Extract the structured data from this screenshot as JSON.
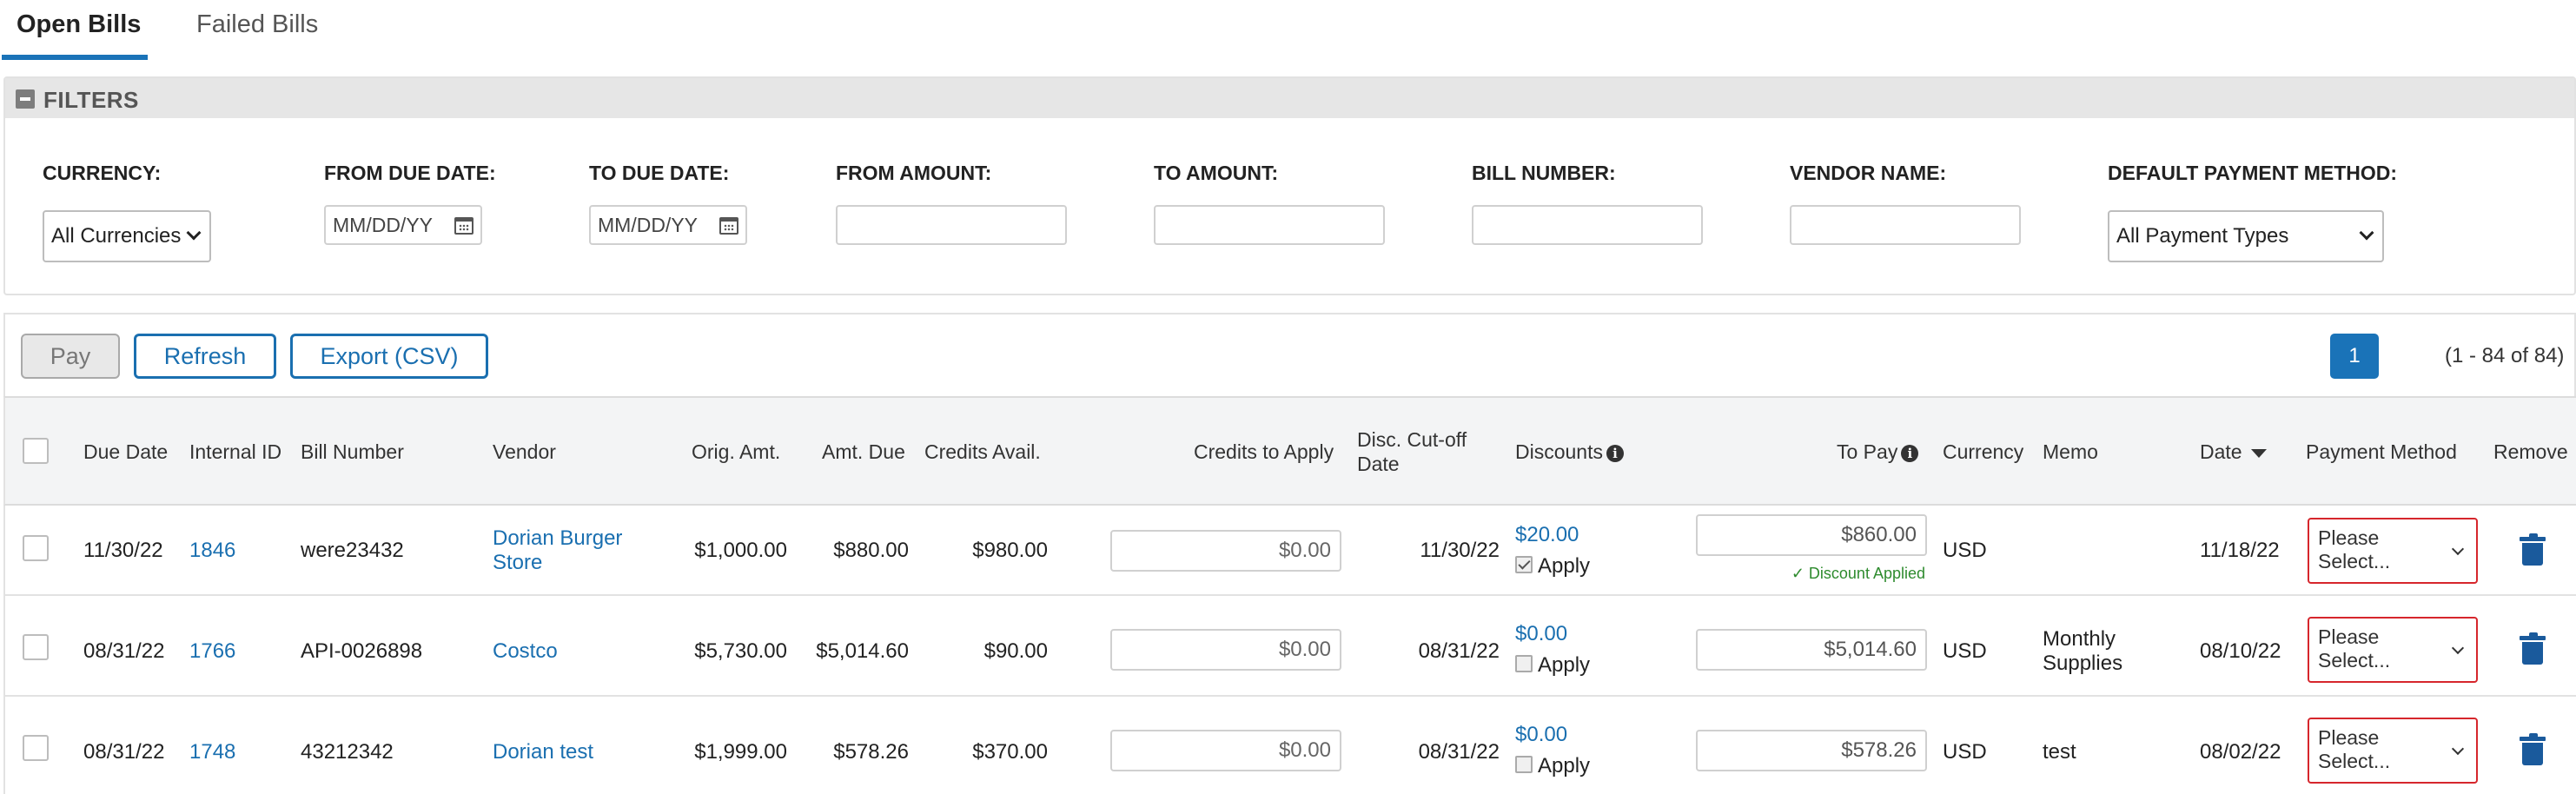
{
  "tabs": {
    "open": "Open Bills",
    "failed": "Failed Bills"
  },
  "filters": {
    "title": "FILTERS",
    "currency_label": "CURRENCY:",
    "currency_value": "All Currencies",
    "from_due_label": "FROM DUE DATE:",
    "from_due_placeholder": "MM/DD/YY",
    "to_due_label": "TO DUE DATE:",
    "to_due_placeholder": "MM/DD/YY",
    "from_amount_label": "FROM AMOUNT:",
    "to_amount_label": "TO AMOUNT:",
    "bill_number_label": "BILL NUMBER:",
    "vendor_name_label": "VENDOR NAME:",
    "payment_method_label": "DEFAULT PAYMENT METHOD:",
    "payment_method_value": "All Payment Types"
  },
  "actions": {
    "pay": "Pay",
    "refresh": "Refresh",
    "export": "Export (CSV)"
  },
  "pagination": {
    "page": "1",
    "info": "(1 - 84 of 84)"
  },
  "columns": {
    "due_date": "Due Date",
    "internal_id": "Internal ID",
    "bill_number": "Bill Number",
    "vendor": "Vendor",
    "orig_amt": "Orig. Amt.",
    "amt_due": "Amt. Due",
    "credits_avail": "Credits Avail.",
    "credits_to_apply": "Credits to Apply",
    "disc_cutoff_1": "Disc. Cut-off",
    "disc_cutoff_2": "Date",
    "discounts": "Discounts",
    "to_pay": "To Pay",
    "currency": "Currency",
    "memo": "Memo",
    "date": "Date",
    "payment_method": "Payment Method",
    "remove": "Remove"
  },
  "rows": [
    {
      "due_date": "11/30/22",
      "internal_id": "1846",
      "bill_number": "were23432",
      "vendor_1": "Dorian Burger",
      "vendor_2": "Store",
      "orig_amt": "$1,000.00",
      "amt_due": "$880.00",
      "credits_avail": "$980.00",
      "credits_to_apply": "$0.00",
      "disc_cutoff": "11/30/22",
      "discount": "$20.00",
      "apply": "Apply",
      "apply_checked": true,
      "to_pay": "$860.00",
      "discount_note": "✓ Discount Applied",
      "currency": "USD",
      "memo_1": "",
      "memo_2": "",
      "date": "11/18/22",
      "pm_1": "Please",
      "pm_2": "Select..."
    },
    {
      "due_date": "08/31/22",
      "internal_id": "1766",
      "bill_number": "API-0026898",
      "vendor_1": "Costco",
      "vendor_2": "",
      "orig_amt": "$5,730.00",
      "amt_due": "$5,014.60",
      "credits_avail": "$90.00",
      "credits_to_apply": "$0.00",
      "disc_cutoff": "08/31/22",
      "discount": "$0.00",
      "apply": "Apply",
      "apply_checked": false,
      "to_pay": "$5,014.60",
      "discount_note": "",
      "currency": "USD",
      "memo_1": "Monthly",
      "memo_2": "Supplies",
      "date": "08/10/22",
      "pm_1": "Please",
      "pm_2": "Select..."
    },
    {
      "due_date": "08/31/22",
      "internal_id": "1748",
      "bill_number": "43212342",
      "vendor_1": "Dorian test",
      "vendor_2": "",
      "orig_amt": "$1,999.00",
      "amt_due": "$578.26",
      "credits_avail": "$370.00",
      "credits_to_apply": "$0.00",
      "disc_cutoff": "08/31/22",
      "discount": "$0.00",
      "apply": "Apply",
      "apply_checked": false,
      "to_pay": "$578.26",
      "discount_note": "",
      "currency": "USD",
      "memo_1": "test",
      "memo_2": "",
      "date": "08/02/22",
      "pm_1": "Please",
      "pm_2": "Select..."
    }
  ],
  "colors": {
    "accent": "#1a73b8",
    "link": "#1a6fb0",
    "error_border": "#d6262c",
    "success": "#2e8b2e"
  }
}
